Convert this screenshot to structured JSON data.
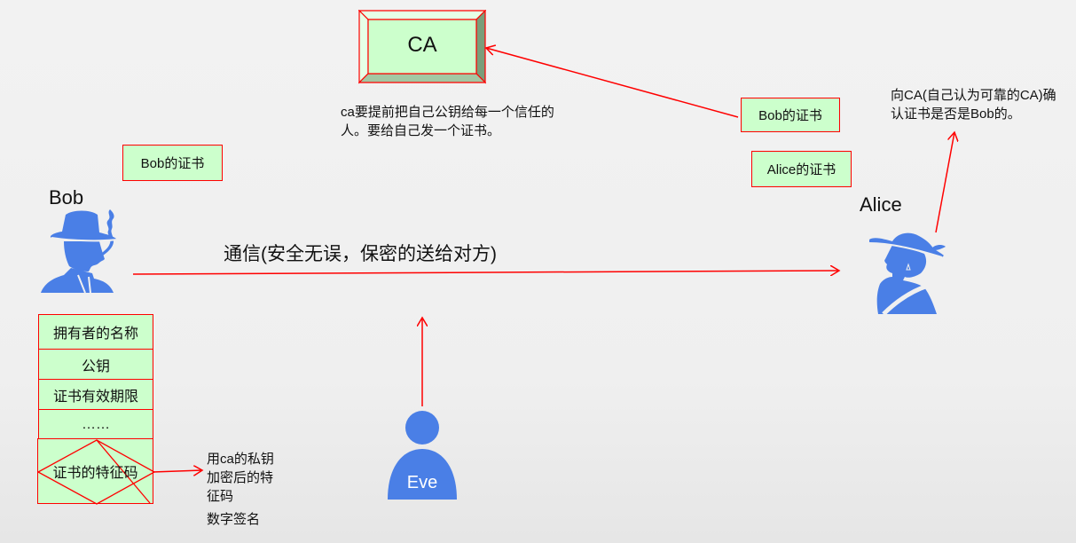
{
  "colors": {
    "background": "#f0f0f0",
    "box_fill": "#ccffcc",
    "box_border": "#ff0000",
    "arrow": "#ff0000",
    "figure": "#4a7fe6"
  },
  "ca": {
    "label": "CA",
    "note_lines": [
      "ca要提前把自己公钥给每一个信任的",
      "人。要给自己发一个证书。"
    ]
  },
  "bob": {
    "name": "Bob",
    "certificate_label": "Bob的证书",
    "icon": "man-with-hat-smoking-icon"
  },
  "alice": {
    "name": "Alice",
    "icon": "woman-with-hat-icon",
    "held_certificates": [
      "Bob的证书",
      "Alice的证书"
    ],
    "verify_note_lines": [
      "向CA(自己认为可靠的CA)确",
      "认证书是否是Bob的。"
    ]
  },
  "eve": {
    "name": "Eve",
    "icon": "person-icon"
  },
  "communication": {
    "label": "通信(安全无误，保密的送给对方)"
  },
  "certificate_fields": [
    "拥有者的名称",
    "公钥",
    "证书有效期限",
    "……",
    "证书的特征码"
  ],
  "signature_note": {
    "lines": [
      "用ca的私钥",
      "加密后的特",
      "征码"
    ],
    "caption": "数字签名"
  }
}
